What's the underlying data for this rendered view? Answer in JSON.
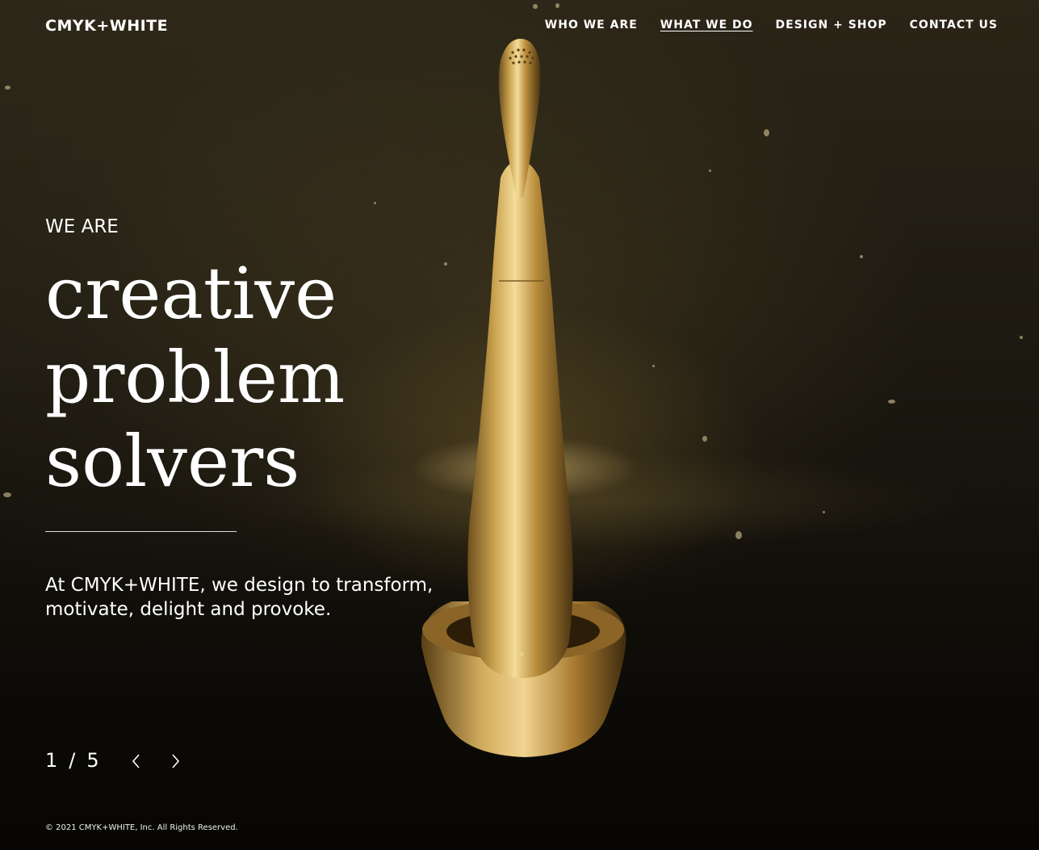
{
  "brand": {
    "logo_text": "CMYK+WHITE"
  },
  "nav": {
    "items": [
      {
        "label": "WHO WE ARE"
      },
      {
        "label": "WHAT WE DO"
      },
      {
        "label": "DESIGN + SHOP"
      },
      {
        "label": "CONTACT US"
      }
    ],
    "active_index": 1
  },
  "hero": {
    "eyebrow": "WE ARE",
    "headline_lines": [
      "creative",
      "problem",
      "solvers"
    ],
    "tagline_line1": "At CMYK+WHITE, we design to transform,",
    "tagline_line2": "motivate, delight and provoke."
  },
  "slider": {
    "current": "1",
    "separator": "/",
    "total": "5",
    "prev_icon": "chevron-left-icon",
    "next_icon": "chevron-right-icon"
  },
  "footer": {
    "copyright": "© 2021 CMYK+WHITE, Inc. All Rights Reserved."
  },
  "colors": {
    "background": "#1b1810",
    "gold": "#c9a24e",
    "text": "#ffffff"
  }
}
